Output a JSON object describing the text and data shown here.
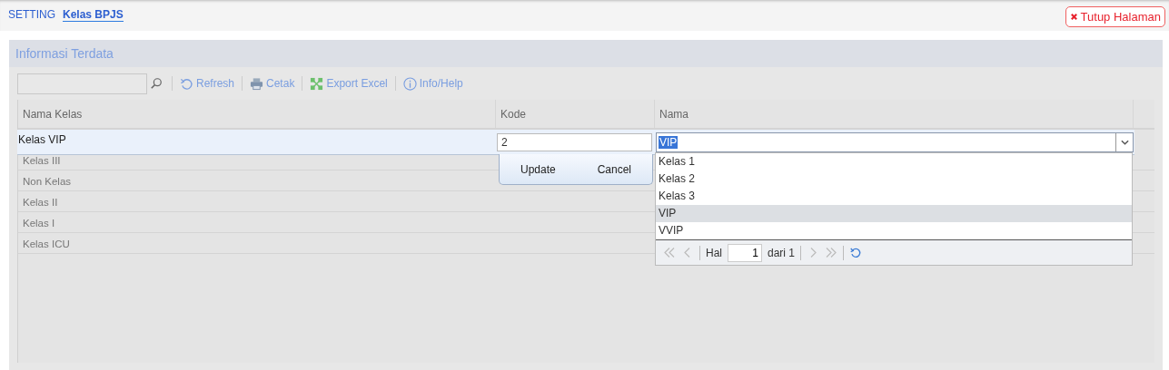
{
  "breadcrumb": [
    {
      "label": "SETTING",
      "selected": false
    },
    {
      "label": "Kelas BPJS",
      "selected": true
    }
  ],
  "close_button": "Tutup Halaman",
  "panel": {
    "title": "Informasi Terdata"
  },
  "toolbar": [
    {
      "kind": "refresh",
      "label": "Refresh"
    },
    {
      "kind": "print",
      "label": "Cetak"
    },
    {
      "kind": "excel",
      "label": "Export Excel"
    },
    {
      "kind": "info",
      "label": "Info/Help"
    }
  ],
  "table": {
    "columns": [
      "Nama Kelas",
      "Kode",
      "Nama"
    ],
    "rows": [
      "Kelas III",
      "Non Kelas",
      "Kelas II",
      "Kelas I",
      "Kelas ICU"
    ]
  },
  "editor": {
    "nama_kelas": "Kelas VIP",
    "kode": "2",
    "nama": "VIP",
    "buttons": [
      "Update",
      "Cancel"
    ]
  },
  "dropdown": {
    "options": [
      {
        "label": "Kelas 1",
        "selected": false
      },
      {
        "label": "Kelas 2",
        "selected": false
      },
      {
        "label": "Kelas 3",
        "selected": false
      },
      {
        "label": "VIP",
        "selected": true
      },
      {
        "label": "VVIP",
        "selected": false
      }
    ],
    "pager": {
      "label": "Hal",
      "page": "1",
      "total": "dari 1"
    }
  }
}
